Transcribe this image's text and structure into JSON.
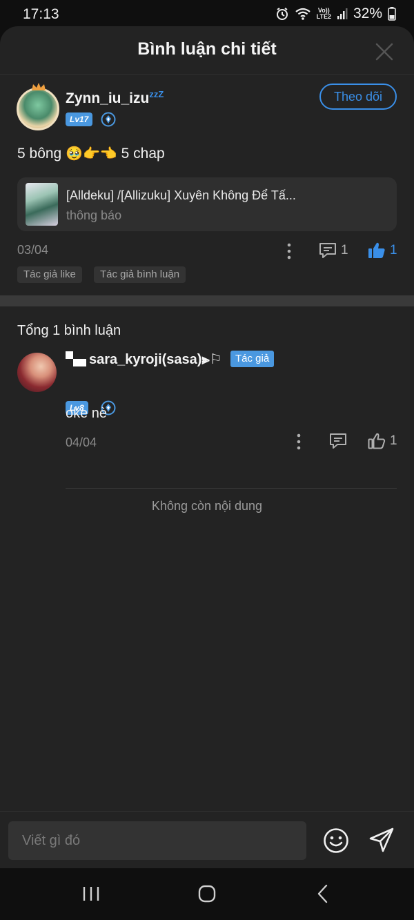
{
  "status_bar": {
    "time": "17:13",
    "lte_top": "Vo))",
    "lte_bottom": "LTE2",
    "battery": "32%"
  },
  "header": {
    "title": "Bình luận chi tiết"
  },
  "post": {
    "username": "Zynn_iu_izu",
    "username_suffix": "zzZ",
    "level": "Lv17",
    "follow_label": "Theo dõi",
    "content_before": "5 bông ",
    "content_after": " 5 chap",
    "linked": {
      "title": "[Alldeku] /[Allizuku] Xuyên Không Để Tấ...",
      "subtitle": "thông báo"
    },
    "date": "03/04",
    "comment_count": "1",
    "like_count": "1",
    "tags": [
      "Tác giả like",
      "Tác giả bình luận"
    ]
  },
  "comments_section": {
    "total_label": "Tổng 1 bình luận",
    "comments": [
      {
        "username": "sara_kyroji(sasa)⫸⚐",
        "badge": "Tác giả",
        "level": "Lv8",
        "text": "oke nè",
        "date": "04/04",
        "like_count": "1"
      }
    ],
    "end_text": "Không còn nội dung"
  },
  "composer": {
    "placeholder": "Viết gì đó"
  },
  "colors": {
    "accent": "#3a8fe8",
    "sheet_bg": "#232323",
    "screen_bg": "#0f0f0f"
  }
}
